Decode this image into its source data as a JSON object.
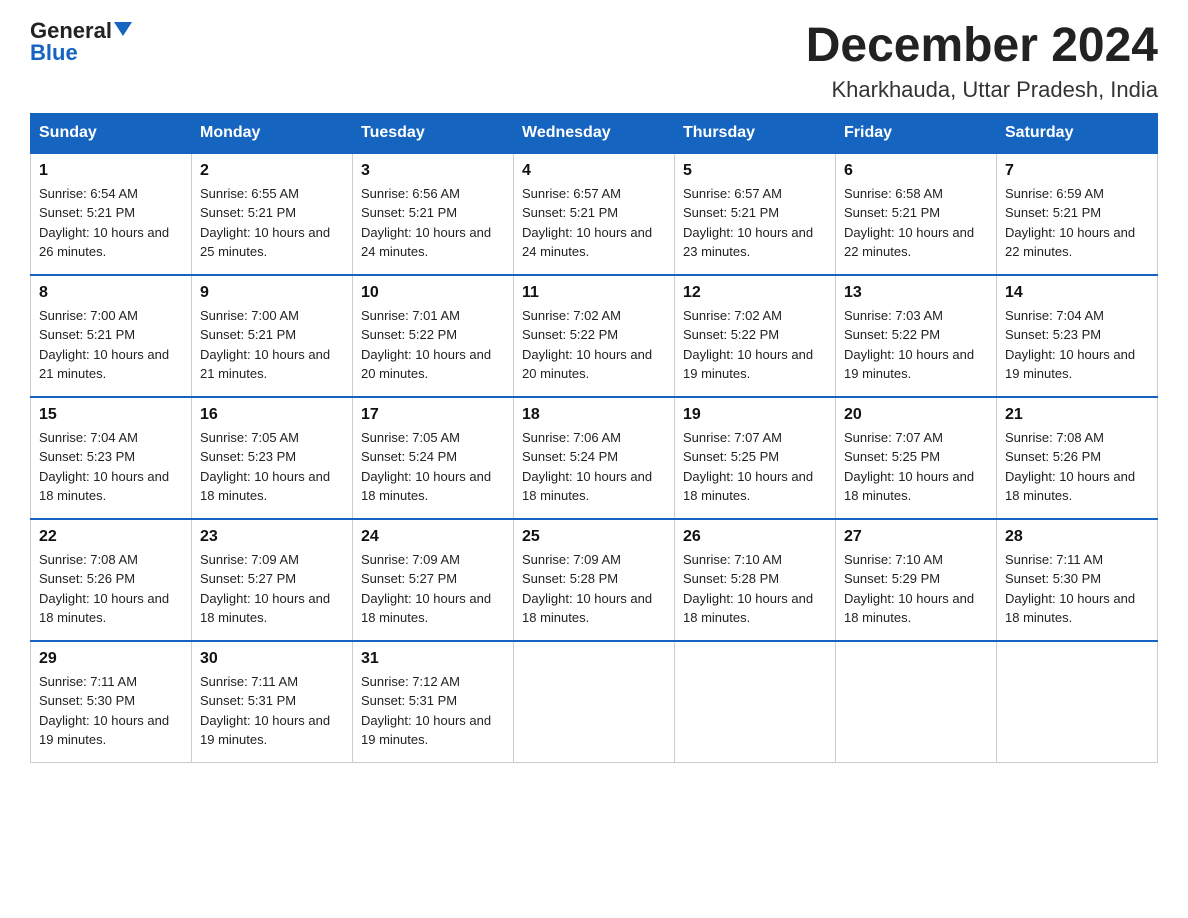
{
  "logo": {
    "general": "General",
    "blue": "Blue",
    "tagline": ""
  },
  "header": {
    "month": "December 2024",
    "location": "Kharkhauda, Uttar Pradesh, India"
  },
  "days_of_week": [
    "Sunday",
    "Monday",
    "Tuesday",
    "Wednesday",
    "Thursday",
    "Friday",
    "Saturday"
  ],
  "weeks": [
    [
      {
        "day": "1",
        "sunrise": "6:54 AM",
        "sunset": "5:21 PM",
        "daylight": "10 hours and 26 minutes."
      },
      {
        "day": "2",
        "sunrise": "6:55 AM",
        "sunset": "5:21 PM",
        "daylight": "10 hours and 25 minutes."
      },
      {
        "day": "3",
        "sunrise": "6:56 AM",
        "sunset": "5:21 PM",
        "daylight": "10 hours and 24 minutes."
      },
      {
        "day": "4",
        "sunrise": "6:57 AM",
        "sunset": "5:21 PM",
        "daylight": "10 hours and 24 minutes."
      },
      {
        "day": "5",
        "sunrise": "6:57 AM",
        "sunset": "5:21 PM",
        "daylight": "10 hours and 23 minutes."
      },
      {
        "day": "6",
        "sunrise": "6:58 AM",
        "sunset": "5:21 PM",
        "daylight": "10 hours and 22 minutes."
      },
      {
        "day": "7",
        "sunrise": "6:59 AM",
        "sunset": "5:21 PM",
        "daylight": "10 hours and 22 minutes."
      }
    ],
    [
      {
        "day": "8",
        "sunrise": "7:00 AM",
        "sunset": "5:21 PM",
        "daylight": "10 hours and 21 minutes."
      },
      {
        "day": "9",
        "sunrise": "7:00 AM",
        "sunset": "5:21 PM",
        "daylight": "10 hours and 21 minutes."
      },
      {
        "day": "10",
        "sunrise": "7:01 AM",
        "sunset": "5:22 PM",
        "daylight": "10 hours and 20 minutes."
      },
      {
        "day": "11",
        "sunrise": "7:02 AM",
        "sunset": "5:22 PM",
        "daylight": "10 hours and 20 minutes."
      },
      {
        "day": "12",
        "sunrise": "7:02 AM",
        "sunset": "5:22 PM",
        "daylight": "10 hours and 19 minutes."
      },
      {
        "day": "13",
        "sunrise": "7:03 AM",
        "sunset": "5:22 PM",
        "daylight": "10 hours and 19 minutes."
      },
      {
        "day": "14",
        "sunrise": "7:04 AM",
        "sunset": "5:23 PM",
        "daylight": "10 hours and 19 minutes."
      }
    ],
    [
      {
        "day": "15",
        "sunrise": "7:04 AM",
        "sunset": "5:23 PM",
        "daylight": "10 hours and 18 minutes."
      },
      {
        "day": "16",
        "sunrise": "7:05 AM",
        "sunset": "5:23 PM",
        "daylight": "10 hours and 18 minutes."
      },
      {
        "day": "17",
        "sunrise": "7:05 AM",
        "sunset": "5:24 PM",
        "daylight": "10 hours and 18 minutes."
      },
      {
        "day": "18",
        "sunrise": "7:06 AM",
        "sunset": "5:24 PM",
        "daylight": "10 hours and 18 minutes."
      },
      {
        "day": "19",
        "sunrise": "7:07 AM",
        "sunset": "5:25 PM",
        "daylight": "10 hours and 18 minutes."
      },
      {
        "day": "20",
        "sunrise": "7:07 AM",
        "sunset": "5:25 PM",
        "daylight": "10 hours and 18 minutes."
      },
      {
        "day": "21",
        "sunrise": "7:08 AM",
        "sunset": "5:26 PM",
        "daylight": "10 hours and 18 minutes."
      }
    ],
    [
      {
        "day": "22",
        "sunrise": "7:08 AM",
        "sunset": "5:26 PM",
        "daylight": "10 hours and 18 minutes."
      },
      {
        "day": "23",
        "sunrise": "7:09 AM",
        "sunset": "5:27 PM",
        "daylight": "10 hours and 18 minutes."
      },
      {
        "day": "24",
        "sunrise": "7:09 AM",
        "sunset": "5:27 PM",
        "daylight": "10 hours and 18 minutes."
      },
      {
        "day": "25",
        "sunrise": "7:09 AM",
        "sunset": "5:28 PM",
        "daylight": "10 hours and 18 minutes."
      },
      {
        "day": "26",
        "sunrise": "7:10 AM",
        "sunset": "5:28 PM",
        "daylight": "10 hours and 18 minutes."
      },
      {
        "day": "27",
        "sunrise": "7:10 AM",
        "sunset": "5:29 PM",
        "daylight": "10 hours and 18 minutes."
      },
      {
        "day": "28",
        "sunrise": "7:11 AM",
        "sunset": "5:30 PM",
        "daylight": "10 hours and 18 minutes."
      }
    ],
    [
      {
        "day": "29",
        "sunrise": "7:11 AM",
        "sunset": "5:30 PM",
        "daylight": "10 hours and 19 minutes."
      },
      {
        "day": "30",
        "sunrise": "7:11 AM",
        "sunset": "5:31 PM",
        "daylight": "10 hours and 19 minutes."
      },
      {
        "day": "31",
        "sunrise": "7:12 AM",
        "sunset": "5:31 PM",
        "daylight": "10 hours and 19 minutes."
      },
      null,
      null,
      null,
      null
    ]
  ]
}
